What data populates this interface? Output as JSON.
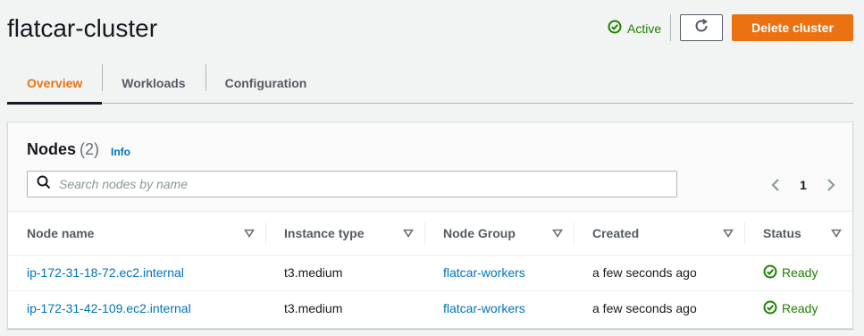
{
  "header": {
    "title": "flatcar-cluster",
    "status_label": "Active",
    "delete_label": "Delete cluster"
  },
  "tabs": [
    {
      "label": "Overview",
      "active": true
    },
    {
      "label": "Workloads",
      "active": false
    },
    {
      "label": "Configuration",
      "active": false
    }
  ],
  "nodes": {
    "title": "Nodes",
    "count": "(2)",
    "info_label": "Info",
    "search_placeholder": "Search nodes by name",
    "page": "1",
    "columns": [
      "Node name",
      "Instance type",
      "Node Group",
      "Created",
      "Status"
    ],
    "rows": [
      {
        "name": "ip-172-31-18-72.ec2.internal",
        "instance_type": "t3.medium",
        "node_group": "flatcar-workers",
        "created": "a few seconds ago",
        "status": "Ready"
      },
      {
        "name": "ip-172-31-42-109.ec2.internal",
        "instance_type": "t3.medium",
        "node_group": "flatcar-workers",
        "created": "a few seconds ago",
        "status": "Ready"
      }
    ]
  },
  "colors": {
    "accent": "#ec7211",
    "link": "#0073bb",
    "success": "#1d8102"
  },
  "icons": [
    "status-ok-icon",
    "refresh-icon",
    "search-icon",
    "chevron-left-icon",
    "chevron-right-icon",
    "sort-caret-icon"
  ]
}
